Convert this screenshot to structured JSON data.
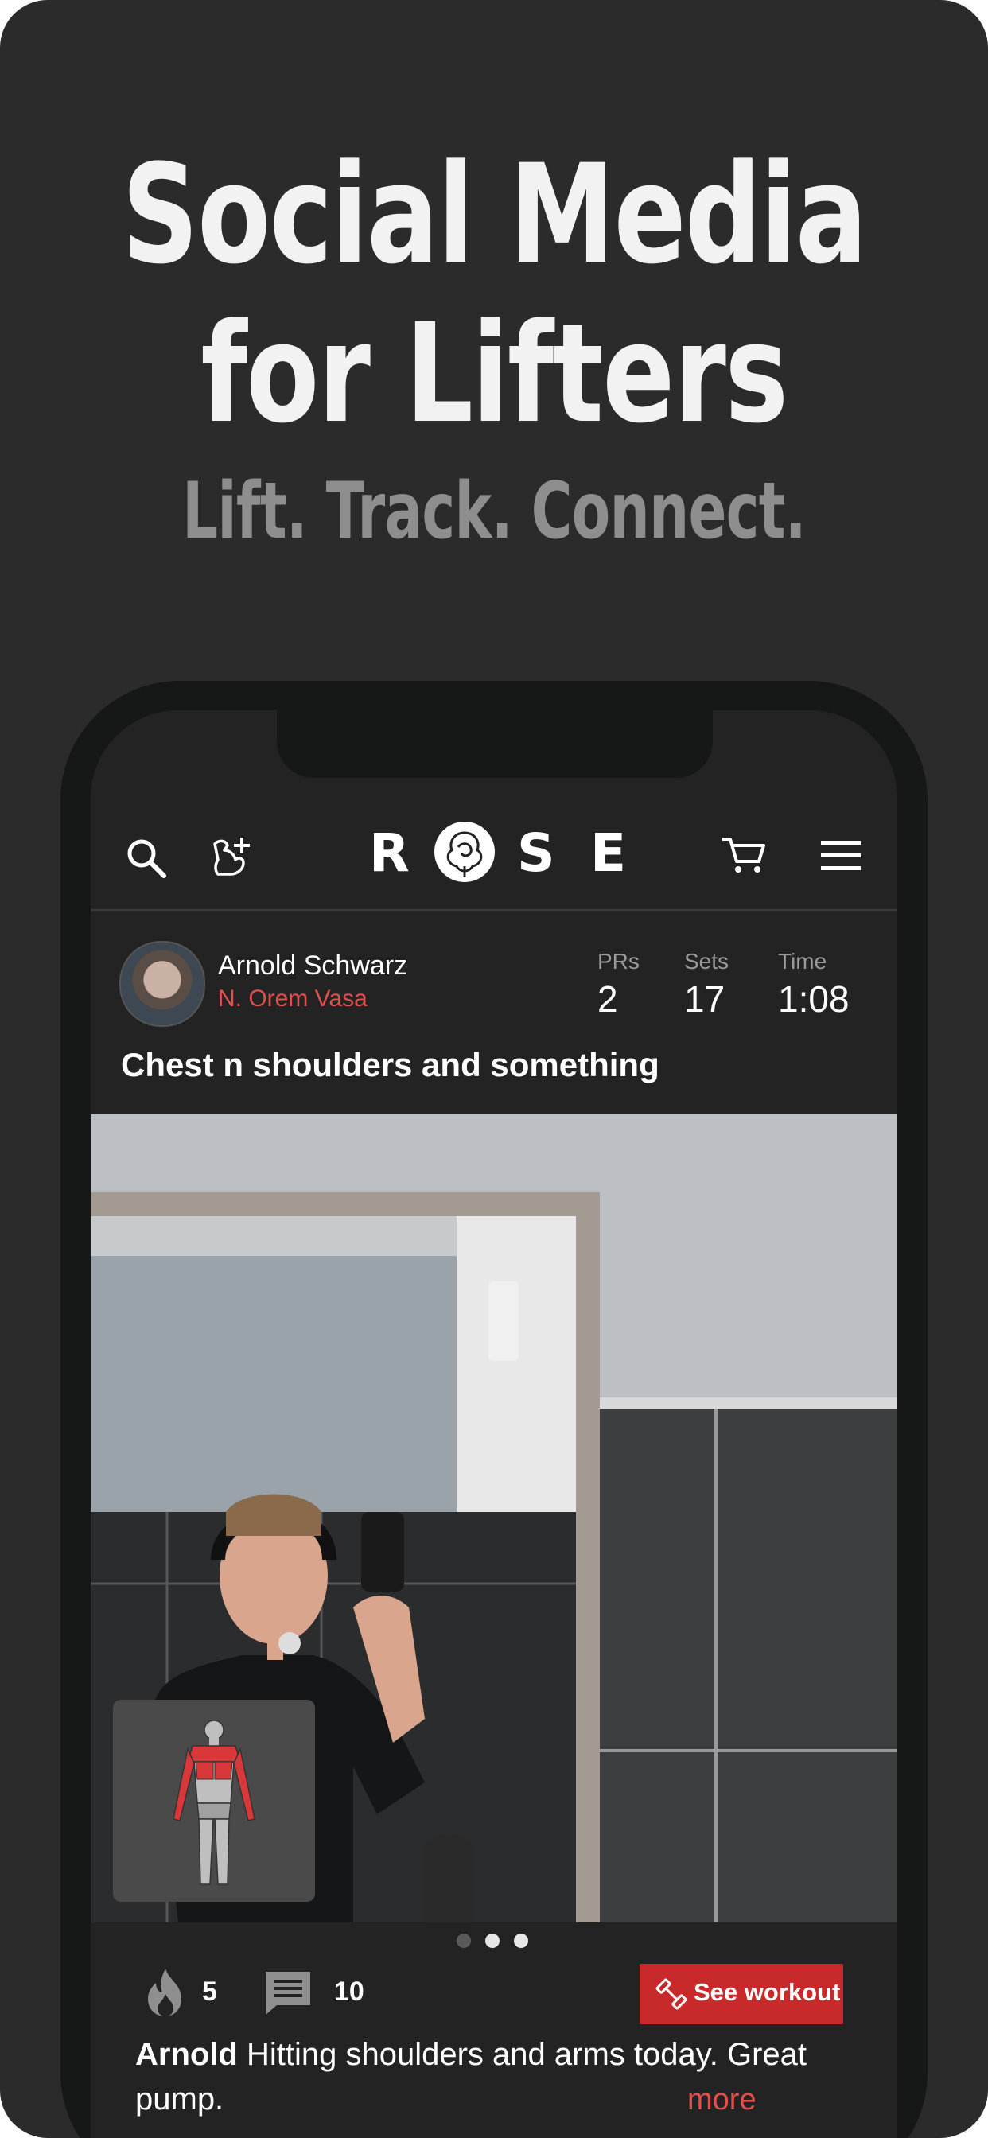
{
  "headline": {
    "line1": "Social Media",
    "line2": "for Lifters",
    "tagline": "Lift. Track. Connect."
  },
  "nav": {
    "logo_letters": [
      "R",
      "S",
      "E"
    ],
    "icons": [
      "search-icon",
      "add-friend-muscle-icon",
      "rose-logo-icon",
      "cart-icon",
      "hamburger-menu-icon"
    ]
  },
  "post": {
    "user_name": "Arnold Schwarz",
    "user_subtitle": "N. Orem Vasa",
    "stats": [
      {
        "label": "PRs",
        "value": "2"
      },
      {
        "label": "Sets",
        "value": "17"
      },
      {
        "label": "Time",
        "value": "1:08"
      }
    ],
    "title": "Chest n shoulders and something",
    "carousel": {
      "count": 3,
      "active": 0
    },
    "fire_count": "5",
    "comment_count": "10",
    "see_workout_label": "See workout",
    "caption_author": "Arnold",
    "caption_text": " Hitting shoulders and arms today. Great pump.",
    "more_label": "more"
  },
  "colors": {
    "background": "#2b2b2b",
    "accent_red": "#c8292a",
    "subtitle_red": "#e0504d",
    "tagline_gray": "#8e8e8e"
  }
}
